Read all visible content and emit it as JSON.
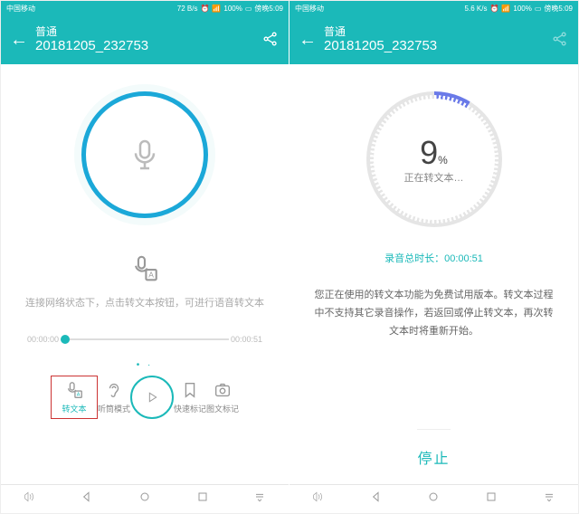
{
  "left": {
    "status": {
      "carrier": "中国移动",
      "speed": "72 B/s",
      "battery": "100%",
      "time": "傍晚5:09"
    },
    "header": {
      "category": "普通",
      "title": "20181205_232753"
    },
    "hint": "连接网络状态下，点击转文本按钮，可进行语音转文本",
    "slider": {
      "start": "00:00:00",
      "end": "00:00:51"
    },
    "toolbar": {
      "transcribe": "转文本",
      "headset": "听筒模式",
      "quick": "快速标记",
      "photo": "图文标记"
    }
  },
  "right": {
    "status": {
      "carrier": "中国移动",
      "speed": "5.6 K/s",
      "battery": "100%",
      "time": "傍晚5:09"
    },
    "header": {
      "category": "普通",
      "title": "20181205_232753"
    },
    "ring": {
      "percent": "9",
      "unit": "%",
      "label": "正在转文本…"
    },
    "duration": {
      "label": "录音总时长：",
      "value": "00:00:51"
    },
    "notice": "您正在使用的转文本功能为免费试用版本。转文本过程中不支持其它录音操作，若返回或停止转文本，再次转文本时将重新开始。",
    "stop": "停止"
  }
}
